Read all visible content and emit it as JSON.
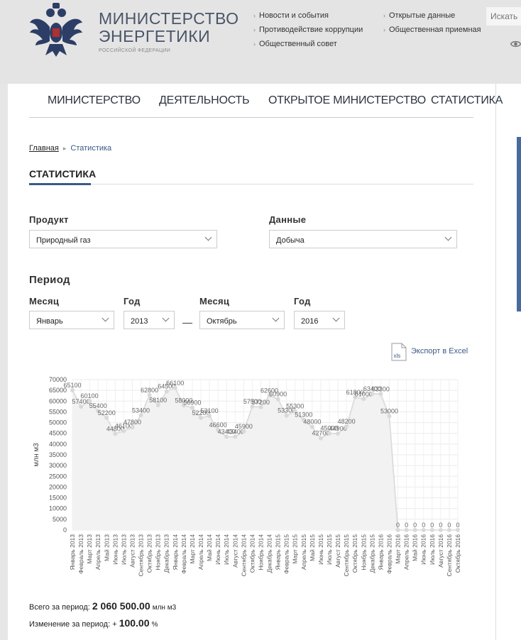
{
  "header": {
    "org_line1": "МИНИСТЕРСТВО",
    "org_line2": "ЭНЕРГЕТИКИ",
    "org_sub": "РОССИЙСКОЙ ФЕДЕРАЦИИ",
    "links_col1": [
      "Новости и события",
      "Противодействие коррупции",
      "Общественный совет"
    ],
    "links_col2": [
      "Открытые данные",
      "Общественная приемная"
    ],
    "search_placeholder": "Искать",
    "emblem_icon": "coat-of-arms-icon",
    "accessibility_icon": "eye-icon"
  },
  "nav": [
    "МИНИСТЕРСТВО",
    "ДЕЯТЕЛЬНОСТЬ",
    "ОТКРЫТОЕ МИНИСТЕРСТВО",
    "СТАТИСТИКА"
  ],
  "breadcrumb": {
    "home": "Главная",
    "current": "Статистика"
  },
  "page_title": "СТАТИСТИКА",
  "filters": {
    "product_label": "Продукт",
    "product_value": "Природный газ",
    "data_label": "Данные",
    "data_value": "Добыча",
    "period_label": "Период",
    "month_label": "Месяц",
    "year_label": "Год",
    "from_month": "Январь",
    "from_year": "2013",
    "separator": "—",
    "to_month": "Октябрь",
    "to_year": "2016"
  },
  "export": {
    "icon_text": "xls",
    "label": "Экспорт в Excel"
  },
  "chart_data": {
    "type": "line",
    "ylabel": "млн м3",
    "ylim": [
      0,
      70000
    ],
    "yticks": [
      0,
      5000,
      10000,
      15000,
      20000,
      25000,
      30000,
      35000,
      40000,
      45000,
      50000,
      55000,
      60000,
      65000,
      70000
    ],
    "grid": true,
    "categories": [
      "Январь 2013",
      "Февраль 2013",
      "Март 2013",
      "Апрель 2013",
      "Май 2013",
      "Июнь 2013",
      "Июль 2013",
      "Август 2013",
      "Сентябрь 2013",
      "Октябрь 2013",
      "Ноябрь 2013",
      "Декабрь 2013",
      "Январь 2014",
      "Февраль 2014",
      "Март 2014",
      "Апрель 2014",
      "Май 2014",
      "Июнь 2014",
      "Июль 2014",
      "Август 2014",
      "Сентябрь 2014",
      "Октябрь 2014",
      "Ноябрь 2014",
      "Декабрь 2014",
      "Январь 2015",
      "Февраль 2015",
      "Март 2015",
      "Апрель 2015",
      "Май 2015",
      "Июнь 2015",
      "Июль 2015",
      "Август 2015",
      "Сентябрь 2015",
      "Октябрь 2015",
      "Ноябрь 2015",
      "Декабрь 2015",
      "Январь 2016",
      "Февраль 2016",
      "Март 2016",
      "Апрель 2016",
      "Май 2016",
      "Июнь 2016",
      "Июль 2016",
      "Август 2016",
      "Сентябрь 2016",
      "Октябрь 2016"
    ],
    "values": [
      65100,
      57400,
      60100,
      55400,
      52200,
      44800,
      46100,
      47800,
      53400,
      62800,
      58100,
      64500,
      66100,
      58000,
      56900,
      52200,
      53100,
      46600,
      43400,
      43400,
      45900,
      57500,
      57200,
      62600,
      60900,
      53300,
      55300,
      51300,
      48000,
      42700,
      45000,
      44900,
      48200,
      61800,
      61000,
      63400,
      63300,
      53000,
      0,
      0,
      0,
      0,
      0,
      0,
      0,
      0
    ],
    "color": "#d9d9d9"
  },
  "summary": {
    "total_label": "Всего за период:",
    "total_value": "2 060 500.00",
    "total_unit": "млн м3",
    "change_label": "Изменение за период:",
    "change_sign": "+",
    "change_value": "100.00",
    "change_unit": "%"
  }
}
